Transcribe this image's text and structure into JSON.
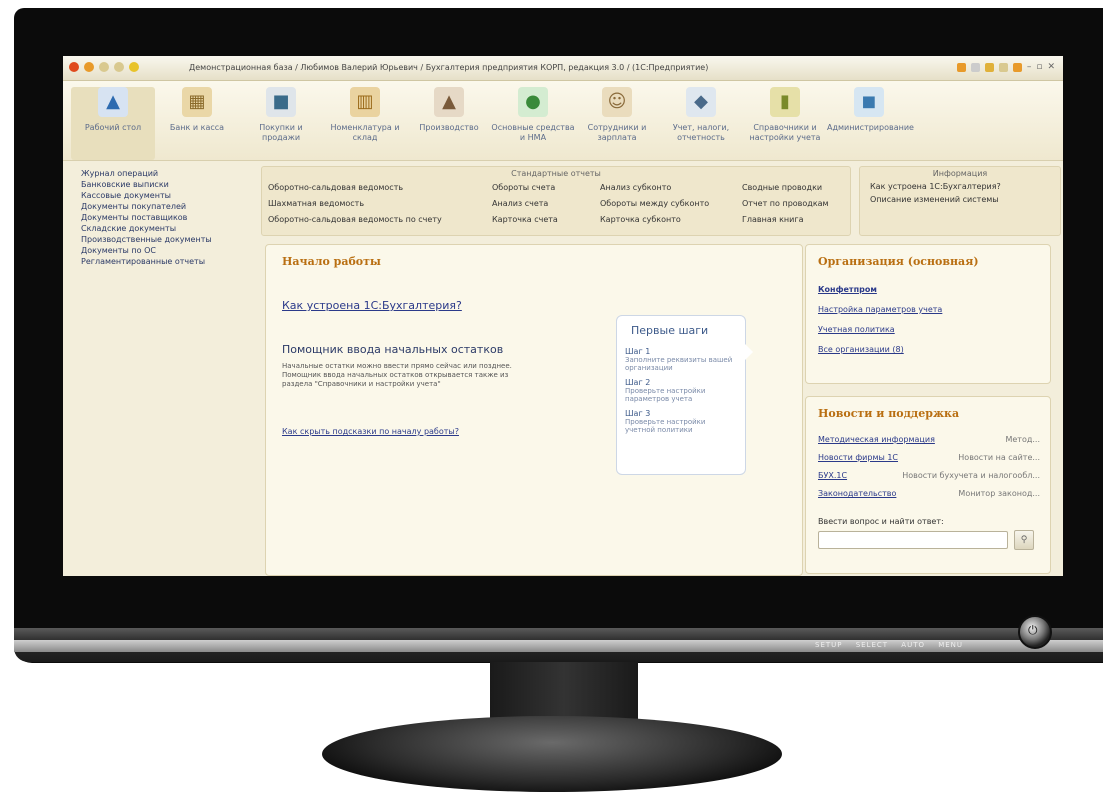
{
  "window": {
    "title": "Демонстрационная база / Любимов Валерий Юрьевич / Бухгалтерия предприятия КОРП, редакция 3.0 / (1С:Предприятие)"
  },
  "sections": [
    {
      "label": "Рабочий стол",
      "icon": "desktop-icon"
    },
    {
      "label": "Банк и касса",
      "icon": "bank-icon"
    },
    {
      "label": "Покупки и продажи",
      "icon": "truck-icon"
    },
    {
      "label": "Номенклатура и склад",
      "icon": "warehouse-icon"
    },
    {
      "label": "Производство",
      "icon": "factory-icon"
    },
    {
      "label": "Основные средства и НМА",
      "icon": "assets-icon"
    },
    {
      "label": "Сотрудники и зарплата",
      "icon": "employee-icon"
    },
    {
      "label": "Учет, налоги, отчетность",
      "icon": "reports-icon"
    },
    {
      "label": "Справочники и настройки учета",
      "icon": "books-icon"
    },
    {
      "label": "Администрирование",
      "icon": "admin-icon"
    }
  ],
  "left_nav": [
    "Журнал операций",
    "Банковские выписки",
    "Кассовые документы",
    "Документы покупателей",
    "Документы поставщиков",
    "Складские документы",
    "Производственные документы",
    "Документы по ОС",
    "Регламентированные отчеты"
  ],
  "standard_reports": {
    "title": "Стандартные отчеты",
    "col1": [
      "Оборотно-сальдовая ведомость",
      "Шахматная ведомость",
      "Оборотно-сальдовая ведомость по счету"
    ],
    "col2": [
      "Обороты счета",
      "Анализ счета",
      "Карточка счета"
    ],
    "col3": [
      "Анализ субконто",
      "Обороты между субконто",
      "Карточка субконто"
    ],
    "col4": [
      "Сводные проводки",
      "Отчет по проводкам",
      "Главная книга"
    ]
  },
  "information": {
    "title": "Информация",
    "items": [
      "Как устроена 1С:Бухгалтерия?",
      "Описание изменений системы"
    ]
  },
  "start": {
    "title": "Начало работы",
    "how_link": "Как устроена 1С:Бухгалтерия?",
    "helper_title": "Помощник ввода начальных остатков",
    "helper_desc": "Начальные остатки можно ввести прямо сейчас или позднее. Помощник ввода начальных остатков открывается также из раздела \"Справочники и настройки учета\"",
    "hide_link": "Как скрыть подсказки по началу работы?"
  },
  "first_steps": {
    "title": "Первые шаги",
    "steps": [
      {
        "label": "Шаг 1",
        "desc": "Заполните реквизиты вашей организации"
      },
      {
        "label": "Шаг 2",
        "desc": "Проверьте настройки параметров учета"
      },
      {
        "label": "Шаг 3",
        "desc": "Проверьте настройки учетной политики"
      }
    ]
  },
  "organization": {
    "title": "Организация (основная)",
    "links": [
      "Конфетпром",
      "Настройка параметров учета",
      "Учетная политика",
      "Все организации (8)"
    ]
  },
  "news": {
    "title": "Новости и поддержка",
    "rows": [
      {
        "link": "Методическая информация",
        "text": "Метод..."
      },
      {
        "link": "Новости фирмы 1С",
        "text": "Новости на сайте..."
      },
      {
        "link": "БУХ.1С",
        "text": "Новости бухучета и налогообл..."
      },
      {
        "link": "Законодательство",
        "text": "Монитор законод..."
      }
    ],
    "question_label": "Ввести вопрос и найти ответ:"
  }
}
